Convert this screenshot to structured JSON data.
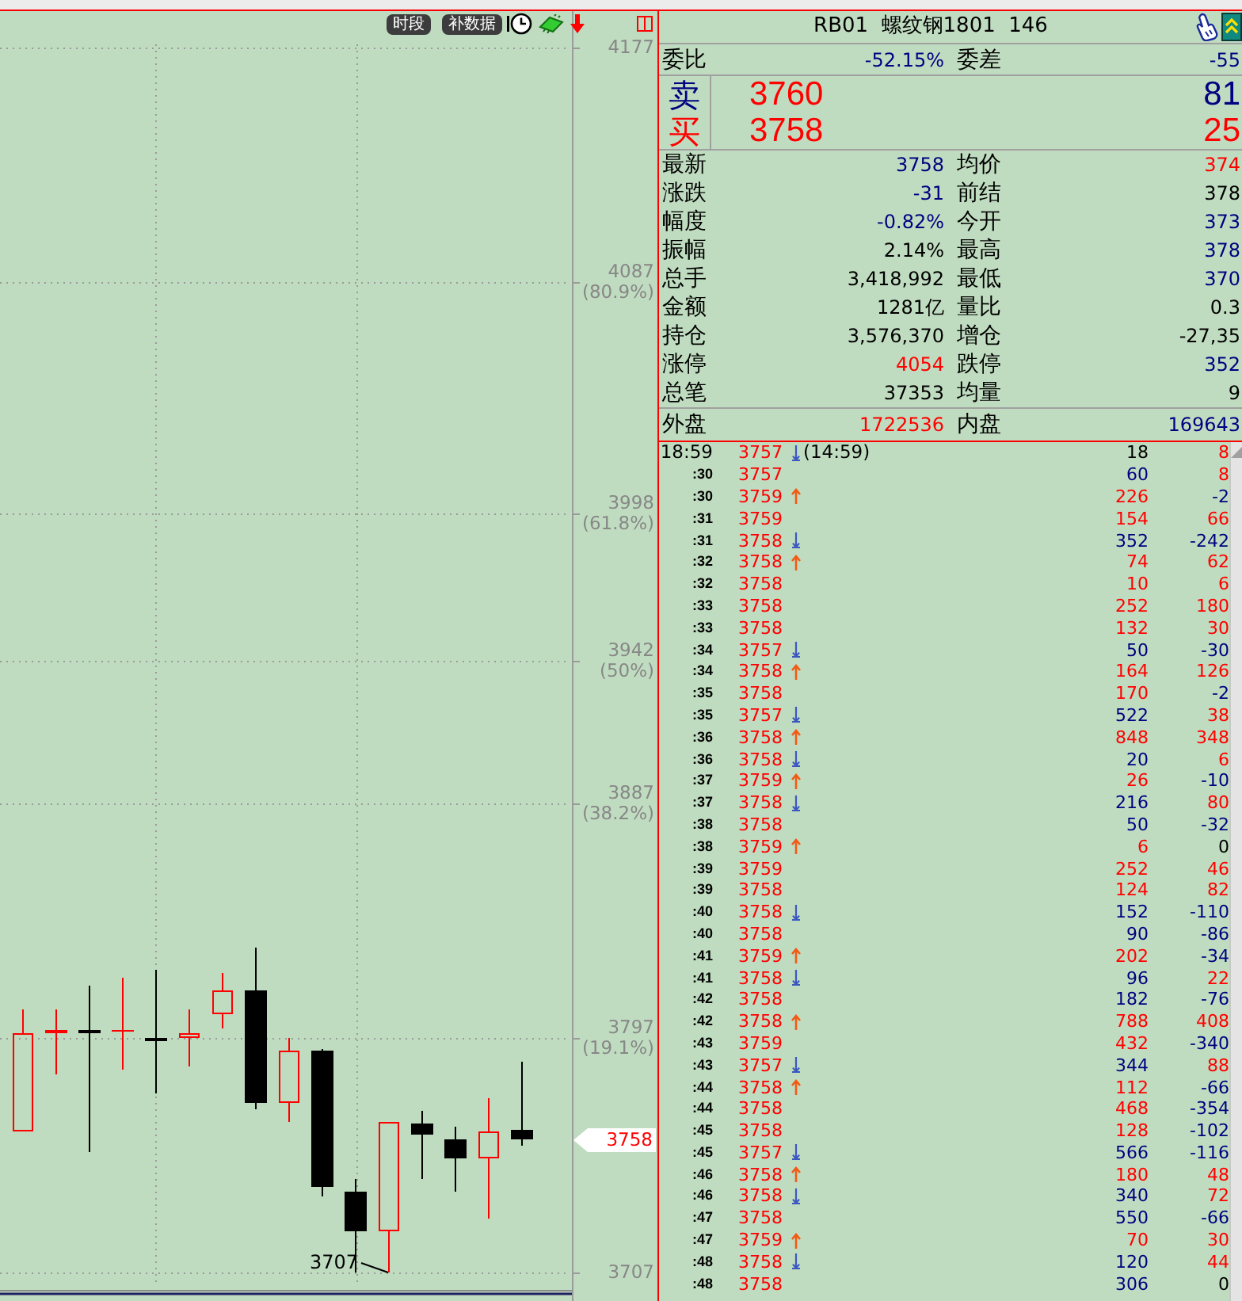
{
  "chart": {
    "toolbar": [
      {
        "label": "时段"
      },
      {
        "label": "补数据"
      }
    ],
    "chart_data": {
      "type": "candlestick",
      "ohlc": [
        [
          3761,
          3808,
          3761,
          3799
        ],
        [
          3799,
          3808,
          3783,
          3800
        ],
        [
          3800,
          3817,
          3753,
          3799
        ],
        [
          3800,
          3820,
          3785,
          3800
        ],
        [
          3797,
          3823,
          3776,
          3796
        ],
        [
          3797,
          3808,
          3786,
          3799
        ],
        [
          3806,
          3822,
          3801,
          3815
        ],
        [
          3815,
          3832,
          3770,
          3772
        ],
        [
          3772,
          3797,
          3765,
          3792
        ],
        [
          3792,
          3793,
          3736,
          3740
        ],
        [
          3738,
          3743,
          3707,
          3723
        ],
        [
          3723,
          3765,
          3707,
          3765
        ],
        [
          3764,
          3769,
          3743,
          3760
        ],
        [
          3758,
          3763,
          3738,
          3751
        ],
        [
          3751,
          3774,
          3728,
          3761
        ],
        [
          3762,
          3788,
          3756,
          3758
        ],
        null
      ],
      "ylim": [
        3701,
        4191
      ],
      "yticks": [
        4177,
        {
          "value": 4087,
          "label": "4087 (80.9%)"
        },
        {
          "value": 3998,
          "label": "3998 (61.8%)"
        },
        {
          "value": 3942,
          "label": "3942 (50%)"
        },
        {
          "value": 3887,
          "label": "3887 (38.2%)"
        },
        {
          "value": 3797,
          "label": "3797 (19.1%)"
        },
        3707
      ],
      "grid": true
    },
    "low_label": "3707",
    "last_price": "3758"
  },
  "quote": {
    "title": "RB01  螺纹钢1801  146",
    "order_balance": [
      {
        "label": "委比",
        "value": "-52.15%"
      },
      {
        "label": "委差",
        "value": "-55"
      }
    ],
    "book": [
      {
        "kind": "sell",
        "label": "卖",
        "price": "3760",
        "volume": "81"
      },
      {
        "kind": "buy",
        "label": "买",
        "price": "3758",
        "volume": "25"
      }
    ],
    "stats": [
      {
        "label": "最新",
        "value": "3758",
        "color": "#000080"
      },
      {
        "label": "均价",
        "value": "374",
        "color": "#ff0000"
      },
      {
        "label": "涨跌",
        "value": "-31",
        "color": "#000080"
      },
      {
        "label": "前结",
        "value": "378",
        "color": "#000000"
      },
      {
        "label": "幅度",
        "value": "-0.82%",
        "color": "#000080"
      },
      {
        "label": "今开",
        "value": "373",
        "color": "#000080"
      },
      {
        "label": "振幅",
        "value": "2.14%",
        "color": "#000000"
      },
      {
        "label": "最高",
        "value": "378",
        "color": "#000080"
      },
      {
        "label": "总手",
        "value": "3,418,992",
        "color": "#000000"
      },
      {
        "label": "最低",
        "value": "370",
        "color": "#000080"
      },
      {
        "label": "金额",
        "value": "1281亿",
        "color": "#000000"
      },
      {
        "label": "量比",
        "value": "0.3",
        "color": "#000000"
      },
      {
        "label": "持仓",
        "value": "3,576,370",
        "color": "#000000"
      },
      {
        "label": "增仓",
        "value": "-27,35",
        "color": "#000000"
      },
      {
        "label": "涨停",
        "value": "4054",
        "color": "#ff0000"
      },
      {
        "label": "跌停",
        "value": "352",
        "color": "#000080"
      },
      {
        "label": "总笔",
        "value": "37353",
        "color": "#000000"
      },
      {
        "label": "均量",
        "value": "9",
        "color": "#000000"
      }
    ],
    "flow": [
      {
        "label": "外盘",
        "value": "1722536",
        "color": "#ff0000"
      },
      {
        "label": "内盘",
        "value": "169643",
        "color": "#000080"
      }
    ]
  },
  "trades": [
    {
      "time": "18:59",
      "price": "3757",
      "kind": "down",
      "note": "(14:59)",
      "volume": {
        "text": "18",
        "color": "#000000"
      },
      "change": {
        "text": "8",
        "color": "#ff0000"
      }
    },
    {
      "time": ":30",
      "price": "3757",
      "kind": "plain",
      "volume": {
        "text": "60",
        "color": "#000080"
      },
      "change": {
        "text": "8",
        "color": "#ff0000"
      }
    },
    {
      "time": ":30",
      "price": "3759",
      "kind": "up",
      "volume": {
        "text": "226",
        "color": "#ff0000"
      },
      "change": {
        "text": "-2",
        "color": "#000080"
      }
    },
    {
      "time": ":31",
      "price": "3759",
      "kind": "plain",
      "volume": {
        "text": "154",
        "color": "#ff0000"
      },
      "change": {
        "text": "66",
        "color": "#ff0000"
      }
    },
    {
      "time": ":31",
      "price": "3758",
      "kind": "down",
      "volume": {
        "text": "352",
        "color": "#000080"
      },
      "change": {
        "text": "-242",
        "color": "#000080"
      }
    },
    {
      "time": ":32",
      "price": "3758",
      "kind": "up",
      "volume": {
        "text": "74",
        "color": "#ff0000"
      },
      "change": {
        "text": "62",
        "color": "#ff0000"
      }
    },
    {
      "time": ":32",
      "price": "3758",
      "kind": "plain",
      "volume": {
        "text": "10",
        "color": "#ff0000"
      },
      "change": {
        "text": "6",
        "color": "#ff0000"
      }
    },
    {
      "time": ":33",
      "price": "3758",
      "kind": "plain",
      "volume": {
        "text": "252",
        "color": "#ff0000"
      },
      "change": {
        "text": "180",
        "color": "#ff0000"
      }
    },
    {
      "time": ":33",
      "price": "3758",
      "kind": "plain",
      "volume": {
        "text": "132",
        "color": "#ff0000"
      },
      "change": {
        "text": "30",
        "color": "#ff0000"
      }
    },
    {
      "time": ":34",
      "price": "3757",
      "kind": "down",
      "volume": {
        "text": "50",
        "color": "#000080"
      },
      "change": {
        "text": "-30",
        "color": "#000080"
      }
    },
    {
      "time": ":34",
      "price": "3758",
      "kind": "up",
      "volume": {
        "text": "164",
        "color": "#ff0000"
      },
      "change": {
        "text": "126",
        "color": "#ff0000"
      }
    },
    {
      "time": ":35",
      "price": "3758",
      "kind": "plain",
      "volume": {
        "text": "170",
        "color": "#ff0000"
      },
      "change": {
        "text": "-2",
        "color": "#000080"
      }
    },
    {
      "time": ":35",
      "price": "3757",
      "kind": "down",
      "volume": {
        "text": "522",
        "color": "#000080"
      },
      "change": {
        "text": "38",
        "color": "#ff0000"
      }
    },
    {
      "time": ":36",
      "price": "3758",
      "kind": "up",
      "volume": {
        "text": "848",
        "color": "#ff0000"
      },
      "change": {
        "text": "348",
        "color": "#ff0000"
      }
    },
    {
      "time": ":36",
      "price": "3758",
      "kind": "down",
      "volume": {
        "text": "20",
        "color": "#000080"
      },
      "change": {
        "text": "6",
        "color": "#ff0000"
      }
    },
    {
      "time": ":37",
      "price": "3759",
      "kind": "up",
      "volume": {
        "text": "26",
        "color": "#ff0000"
      },
      "change": {
        "text": "-10",
        "color": "#000080"
      }
    },
    {
      "time": ":37",
      "price": "3758",
      "kind": "down",
      "volume": {
        "text": "216",
        "color": "#000080"
      },
      "change": {
        "text": "80",
        "color": "#ff0000"
      }
    },
    {
      "time": ":38",
      "price": "3758",
      "kind": "plain",
      "volume": {
        "text": "50",
        "color": "#000080"
      },
      "change": {
        "text": "-32",
        "color": "#000080"
      }
    },
    {
      "time": ":38",
      "price": "3759",
      "kind": "up",
      "volume": {
        "text": "6",
        "color": "#ff0000"
      },
      "change": {
        "text": "0",
        "color": "#000000"
      }
    },
    {
      "time": ":39",
      "price": "3759",
      "kind": "plain",
      "volume": {
        "text": "252",
        "color": "#ff0000"
      },
      "change": {
        "text": "46",
        "color": "#ff0000"
      }
    },
    {
      "time": ":39",
      "price": "3758",
      "kind": "plain",
      "volume": {
        "text": "124",
        "color": "#ff0000"
      },
      "change": {
        "text": "82",
        "color": "#ff0000"
      }
    },
    {
      "time": ":40",
      "price": "3758",
      "kind": "down",
      "volume": {
        "text": "152",
        "color": "#000080"
      },
      "change": {
        "text": "-110",
        "color": "#000080"
      }
    },
    {
      "time": ":40",
      "price": "3758",
      "kind": "plain",
      "volume": {
        "text": "90",
        "color": "#000080"
      },
      "change": {
        "text": "-86",
        "color": "#000080"
      }
    },
    {
      "time": ":41",
      "price": "3759",
      "kind": "up",
      "volume": {
        "text": "202",
        "color": "#ff0000"
      },
      "change": {
        "text": "-34",
        "color": "#000080"
      }
    },
    {
      "time": ":41",
      "price": "3758",
      "kind": "down",
      "volume": {
        "text": "96",
        "color": "#000080"
      },
      "change": {
        "text": "22",
        "color": "#ff0000"
      }
    },
    {
      "time": ":42",
      "price": "3758",
      "kind": "plain",
      "volume": {
        "text": "182",
        "color": "#000080"
      },
      "change": {
        "text": "-76",
        "color": "#000080"
      }
    },
    {
      "time": ":42",
      "price": "3758",
      "kind": "up",
      "volume": {
        "text": "788",
        "color": "#ff0000"
      },
      "change": {
        "text": "408",
        "color": "#ff0000"
      }
    },
    {
      "time": ":43",
      "price": "3759",
      "kind": "plain",
      "volume": {
        "text": "432",
        "color": "#ff0000"
      },
      "change": {
        "text": "-340",
        "color": "#000080"
      }
    },
    {
      "time": ":43",
      "price": "3757",
      "kind": "down",
      "volume": {
        "text": "344",
        "color": "#000080"
      },
      "change": {
        "text": "88",
        "color": "#ff0000"
      }
    },
    {
      "time": ":44",
      "price": "3758",
      "kind": "up",
      "volume": {
        "text": "112",
        "color": "#ff0000"
      },
      "change": {
        "text": "-66",
        "color": "#000080"
      }
    },
    {
      "time": ":44",
      "price": "3758",
      "kind": "plain",
      "volume": {
        "text": "468",
        "color": "#ff0000"
      },
      "change": {
        "text": "-354",
        "color": "#000080"
      }
    },
    {
      "time": ":45",
      "price": "3758",
      "kind": "plain",
      "volume": {
        "text": "128",
        "color": "#ff0000"
      },
      "change": {
        "text": "-102",
        "color": "#000080"
      }
    },
    {
      "time": ":45",
      "price": "3757",
      "kind": "down",
      "volume": {
        "text": "566",
        "color": "#000080"
      },
      "change": {
        "text": "-116",
        "color": "#000080"
      }
    },
    {
      "time": ":46",
      "price": "3758",
      "kind": "up",
      "volume": {
        "text": "180",
        "color": "#ff0000"
      },
      "change": {
        "text": "48",
        "color": "#ff0000"
      }
    },
    {
      "time": ":46",
      "price": "3758",
      "kind": "down",
      "volume": {
        "text": "340",
        "color": "#000080"
      },
      "change": {
        "text": "72",
        "color": "#ff0000"
      }
    },
    {
      "time": ":47",
      "price": "3758",
      "kind": "plain",
      "volume": {
        "text": "550",
        "color": "#000080"
      },
      "change": {
        "text": "-66",
        "color": "#000080"
      }
    },
    {
      "time": ":47",
      "price": "3759",
      "kind": "up",
      "volume": {
        "text": "70",
        "color": "#ff0000"
      },
      "change": {
        "text": "30",
        "color": "#ff0000"
      }
    },
    {
      "time": ":48",
      "price": "3758",
      "kind": "down",
      "volume": {
        "text": "120",
        "color": "#000080"
      },
      "change": {
        "text": "44",
        "color": "#ff0000"
      }
    },
    {
      "time": ":48",
      "price": "3758",
      "kind": "plain",
      "volume": {
        "text": "306",
        "color": "#000080"
      },
      "change": {
        "text": "0",
        "color": "#000000"
      }
    }
  ]
}
